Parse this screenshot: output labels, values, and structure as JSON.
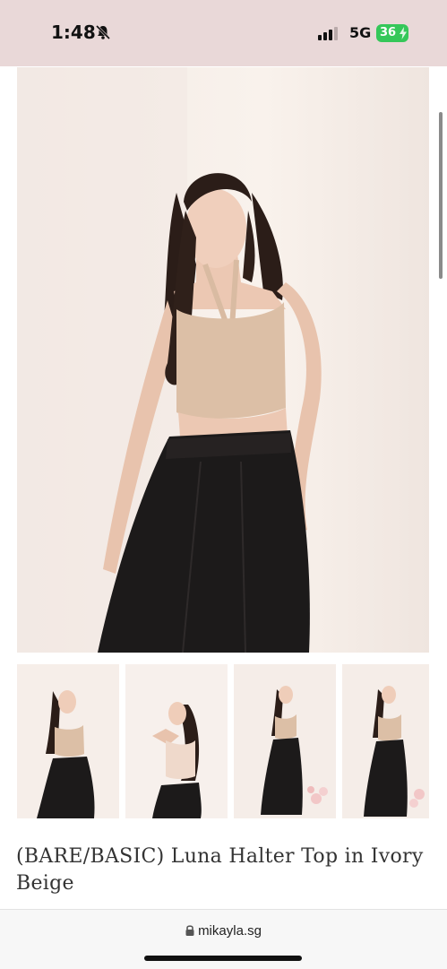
{
  "status_bar": {
    "time": "1:48",
    "network": "5G",
    "battery": "36"
  },
  "product": {
    "title": "(BARE/BASIC) Luna Halter Top in Ivory Beige",
    "thumbnails": [
      "thumbnail-1",
      "thumbnail-2",
      "thumbnail-3",
      "thumbnail-4"
    ]
  },
  "browser": {
    "url": "mikayla.sg"
  },
  "colors": {
    "status_bg": "#e9d8d8",
    "battery_green": "#35c759",
    "top_beige": "#dcbfa6",
    "pants_black": "#1c1a1a"
  },
  "icons": [
    "bell-slash-icon",
    "signal-icon",
    "bolt-icon",
    "lock-icon"
  ]
}
